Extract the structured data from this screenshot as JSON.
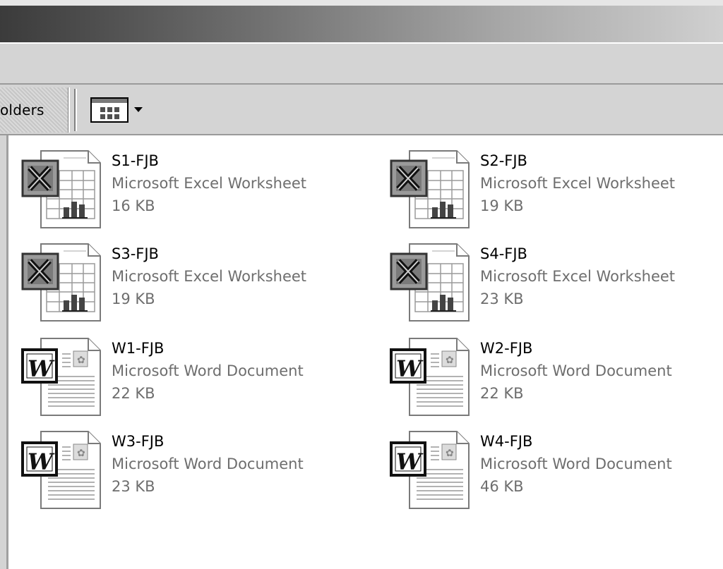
{
  "toolbar": {
    "folders_label": "olders"
  },
  "files": [
    {
      "name": "S1-FJB",
      "type": "Microsoft Excel Worksheet",
      "size": "16 KB",
      "icon": "excel-icon"
    },
    {
      "name": "S2-FJB",
      "type": "Microsoft Excel Worksheet",
      "size": "19 KB",
      "icon": "excel-icon"
    },
    {
      "name": "S3-FJB",
      "type": "Microsoft Excel Worksheet",
      "size": "19 KB",
      "icon": "excel-icon"
    },
    {
      "name": "S4-FJB",
      "type": "Microsoft Excel Worksheet",
      "size": "23 KB",
      "icon": "excel-icon"
    },
    {
      "name": "W1-FJB",
      "type": "Microsoft Word Document",
      "size": "22 KB",
      "icon": "word-icon"
    },
    {
      "name": "W2-FJB",
      "type": "Microsoft Word Document",
      "size": "22 KB",
      "icon": "word-icon"
    },
    {
      "name": "W3-FJB",
      "type": "Microsoft Word Document",
      "size": "23 KB",
      "icon": "word-icon"
    },
    {
      "name": "W4-FJB",
      "type": "Microsoft Word Document",
      "size": "46 KB",
      "icon": "word-icon"
    }
  ]
}
